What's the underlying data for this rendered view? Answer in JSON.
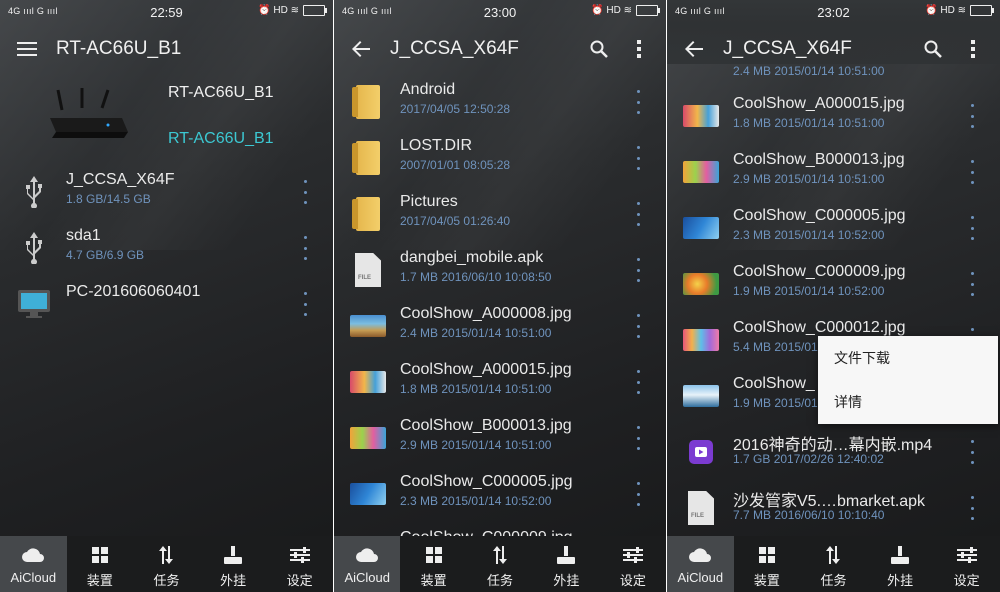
{
  "colors": {
    "accent": "#3cc8d2",
    "meta": "#6f93bd",
    "tab_active": "#45484b",
    "tab_bg": "#1b1c1d"
  },
  "tabs": [
    {
      "label": "AiCloud",
      "icon": "cloud-icon"
    },
    {
      "label": "装置",
      "icon": "grid-icon"
    },
    {
      "label": "任务",
      "icon": "transfer-arrows-icon"
    },
    {
      "label": "外挂",
      "icon": "joystick-icon"
    },
    {
      "label": "设定",
      "icon": "sliders-icon"
    }
  ],
  "screens": [
    {
      "status": {
        "signal": "4G ıııl G ıııl",
        "time": "22:59",
        "icons": "⏰ HD ≋"
      },
      "title": "RT-AC66U_B1",
      "router": {
        "name": "RT-AC66U_B1",
        "name_accent": "RT-AC66U_B1"
      },
      "items": [
        {
          "name": "J_CCSA_X64F",
          "meta": "1.8 GB/14.5 GB",
          "icon": "usb-icon"
        },
        {
          "name": "sda1",
          "meta": "4.7 GB/6.9 GB",
          "icon": "usb-icon"
        },
        {
          "name": "PC-201606060401",
          "meta": "",
          "icon": "monitor-icon"
        }
      ]
    },
    {
      "status": {
        "signal": "4G ıııl G ıııl",
        "time": "23:00",
        "icons": "⏰ HD ≋"
      },
      "title": "J_CCSA_X64F",
      "items": [
        {
          "name": "Android",
          "meta": "2017/04/05 12:50:28",
          "icon": "folder"
        },
        {
          "name": "LOST.DIR",
          "meta": "2007/01/01 08:05:28",
          "icon": "folder"
        },
        {
          "name": "Pictures",
          "meta": "2017/04/05 01:26:40",
          "icon": "folder"
        },
        {
          "name": "dangbei_mobile.apk",
          "meta": "1.7 MB 2016/06/10 10:08:50",
          "icon": "file"
        },
        {
          "name": "CoolShow_A000008.jpg",
          "meta": "2.4 MB 2015/01/14 10:51:00",
          "icon": "t1"
        },
        {
          "name": "CoolShow_A000015.jpg",
          "meta": "1.8 MB 2015/01/14 10:51:00",
          "icon": "t2"
        },
        {
          "name": "CoolShow_B000013.jpg",
          "meta": "2.9 MB 2015/01/14 10:51:00",
          "icon": "t3"
        },
        {
          "name": "CoolShow_C000005.jpg",
          "meta": "2.3 MB 2015/01/14 10:52:00",
          "icon": "t4"
        },
        {
          "name": "CoolShow_C000009.jpg",
          "meta": "",
          "icon": "t5"
        }
      ]
    },
    {
      "status": {
        "signal": "4G ıııl G ıııl",
        "time": "23:02",
        "icons": "⏰ HD ≋"
      },
      "title": "J_CCSA_X64F",
      "partial_meta": "2.4 MB 2015/01/14 10:51:00",
      "items": [
        {
          "name": "CoolShow_A000015.jpg",
          "meta": "1.8 MB 2015/01/14 10:51:00",
          "icon": "t2"
        },
        {
          "name": "CoolShow_B000013.jpg",
          "meta": "2.9 MB 2015/01/14 10:51:00",
          "icon": "t3"
        },
        {
          "name": "CoolShow_C000005.jpg",
          "meta": "2.3 MB 2015/01/14 10:52:00",
          "icon": "t4"
        },
        {
          "name": "CoolShow_C000009.jpg",
          "meta": "1.9 MB 2015/01/14 10:52:00",
          "icon": "t5"
        },
        {
          "name": "CoolShow_C000012.jpg",
          "meta": "5.4 MB 2015/01/14 10:52:00",
          "icon": "t6"
        },
        {
          "name": "CoolShow_",
          "meta": "1.9 MB 2015/01",
          "icon": "t7"
        },
        {
          "name": "2016神奇的动…幕内嵌.mp4",
          "meta": "1.7 GB 2017/02/26 12:40:02",
          "icon": "video"
        },
        {
          "name": "沙发管家V5.…bmarket.apk",
          "meta": "7.7 MB 2016/06/10 10:10:40",
          "icon": "file"
        }
      ],
      "menu": [
        "文件下载",
        "详情"
      ]
    }
  ]
}
